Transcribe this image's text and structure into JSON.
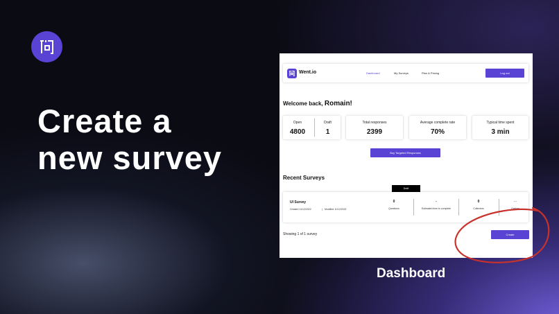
{
  "promo": {
    "headline": "Create a new survey",
    "caption": "Dashboard"
  },
  "nav": {
    "brand": "Went.io",
    "links": [
      "Dashboard",
      "My Surveys",
      "Plan & Pricing"
    ],
    "logout": "Log out"
  },
  "welcome": {
    "prefix": "Welcome back,",
    "name": "Romain!"
  },
  "stats": {
    "open_label": "Open",
    "open_value": "4800",
    "draft_label": "Draft",
    "draft_value": "1",
    "responses_label": "Total responses",
    "responses_value": "2399",
    "complete_label": "Average complete rate",
    "complete_value": "70%",
    "time_label": "Typical time spent",
    "time_value": "3 min"
  },
  "buy_button": "Buy Targeted Responses",
  "recent": {
    "title": "Recent Surveys",
    "status_tag": "Draft",
    "survey": {
      "name": "UI Survey",
      "created": "Created 11/12/2022",
      "separator": "|",
      "modified": "Modified 11/12/2022",
      "questions_value": "0",
      "questions_label": "Questions",
      "time_value": "-",
      "time_label": "Estimated time to complete",
      "collectors_value": "0",
      "collectors_label": "Collectors",
      "more": "...",
      "options_label": "Options"
    }
  },
  "showing": "Showing 1 of 1 survey",
  "create_button": "Create",
  "colors": {
    "accent": "#5843d4",
    "annotation": "#c8322c"
  },
  "icons": {
    "logo": "went-logo-icon",
    "annotation": "highlight-circle"
  }
}
